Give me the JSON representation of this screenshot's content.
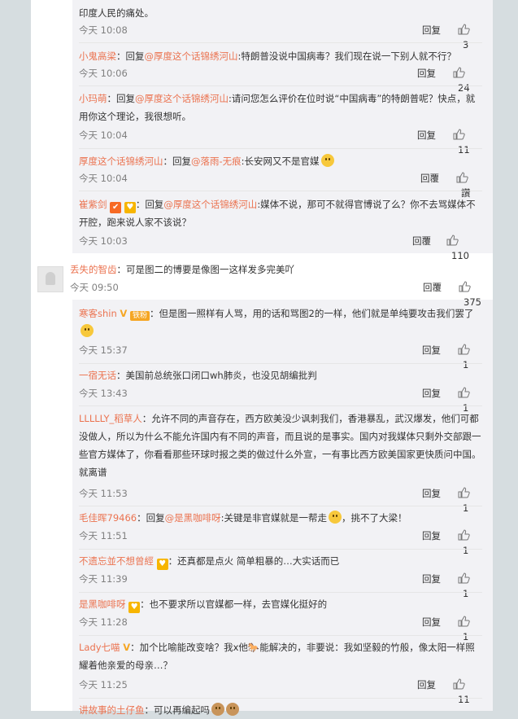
{
  "labels": {
    "reply": "回复",
    "reply_to": "回复"
  },
  "comments": {
    "c0": {
      "text": "印度人民的痛处。",
      "time": "今天 10:08",
      "likes": "3"
    },
    "c1": {
      "author": "小鬼高梁",
      "sep": "：",
      "target": "@厚度这个话锦绣河山",
      "body": ":特朗普没说中国病毒？我们现在说一下别人就不行？",
      "time": "今天 10:06",
      "likes": "24"
    },
    "c2": {
      "author": "小玛萌",
      "sep": "：",
      "target": "@厚度这个话锦绣河山",
      "body": ":请问您怎么评价在位时说“中国病毒”的特朗普呢？快点，就用你这个理论，我很想听。",
      "time": "今天 10:04",
      "likes": "11"
    },
    "c3": {
      "author": "厚度这个话锦绣河山",
      "sep": "：",
      "target": "@落雨-无痕",
      "body": ":长安网又不是官媒",
      "time": "今天 10:04",
      "reply_label": "回覆",
      "likes": "讚"
    },
    "c4": {
      "author": "崔紫剑",
      "sep": "：",
      "target": "@厚度这个话锦绣河山",
      "body": ":媒体不说，那可不就得官博说了么？你不去骂媒体不开腔，跑来说人家不该说？",
      "time": "今天 10:03",
      "reply_label": "回覆",
      "likes": "110"
    },
    "c5": {
      "author": "丢失的智齿",
      "sep": "：",
      "body": "可是图二的博要是像图一这样发多完美吖",
      "time": "今天 09:50",
      "reply_label": "回覆",
      "likes": "375"
    },
    "c6": {
      "author": "寒客shin",
      "fans": "铁粉",
      "sep": "：",
      "body": "但是图一照样有人骂，用的话和骂图2的一样，他们就是单纯要攻击我们罢了",
      "time": "今天 15:37",
      "likes": "1"
    },
    "c7": {
      "author": "一宿无话",
      "sep": "：",
      "body": "美国前总统张口闭口wh肺炎，也没见胡编批判",
      "time": "今天 13:43",
      "likes": "1"
    },
    "c8": {
      "author": "LLLLLY_稻草人",
      "sep": "：",
      "body": "允许不同的声音存在，西方欧美没少讽刺我们，香港暴乱，武汉爆发，他们可都没做人，所以为什么不能允许国内有不同的声音，而且说的是事实。国内对我媒体只剩外交部跟一些官方媒体了，你看看那些环球时报之类的做过什么外宣，一有事比西方欧美国家更快质问中国。就离谱",
      "time": "今天 11:53",
      "likes": "1"
    },
    "c9": {
      "author": "毛佳晖79466",
      "sep": "：",
      "target": "@是黑咖啡呀",
      "body": ":关键是非官媒就是一帮走",
      "body2": "，挑不了大梁！",
      "time": "今天 11:51",
      "likes": "1"
    },
    "c10": {
      "author": "不遗忘並不想曾經",
      "sep": "：",
      "body": "还真都是点火 简单粗暴的…大实话而已",
      "time": "今天 11:39",
      "likes": "1"
    },
    "c11": {
      "author": "是黑咖啡呀",
      "sep": "：",
      "body": "也不要求所以官媒都一样，去官媒化挺好的",
      "time": "今天 11:28",
      "likes": "1"
    },
    "c12": {
      "author": "Lady七喵",
      "sep": "：",
      "body": "加个比喻能改变啥？我x他🐎能解决的，非要说：我如坚毅的竹般，像太阳一样照耀着他亲爱的母亲…？",
      "time": "今天 11:25",
      "likes": "11"
    },
    "c13": {
      "author": "讲故事的土仔鱼",
      "sep": "：",
      "body": "可以再编起吗"
    }
  }
}
